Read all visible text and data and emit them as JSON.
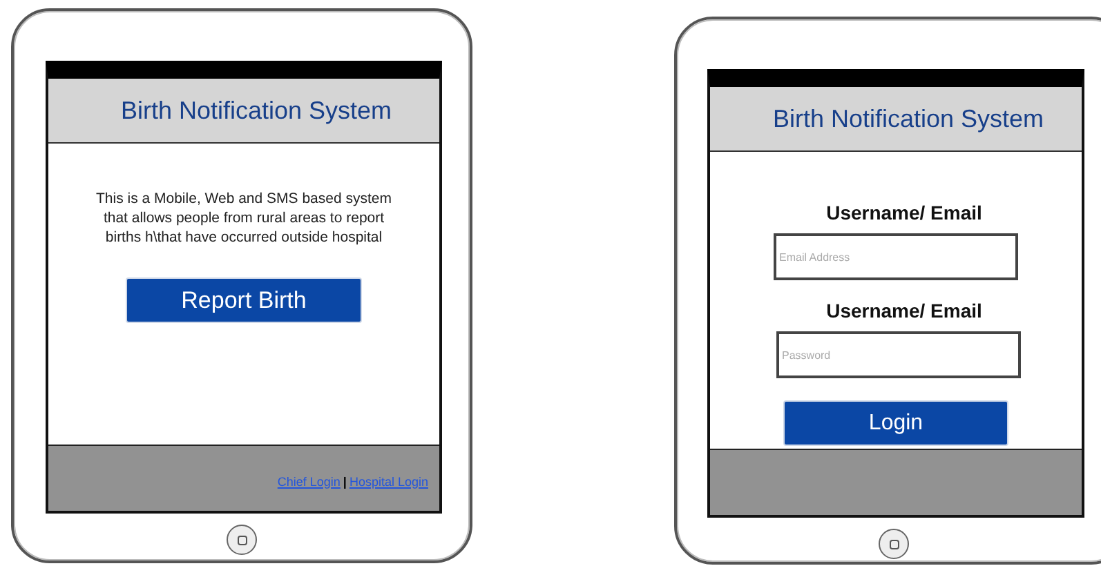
{
  "screens": [
    {
      "kind": "home",
      "title": "Birth Notification System",
      "description": "This is a Mobile, Web and SMS based system\nthat allows people from rural areas to report\nbirths h\\that have occurred outside hospital",
      "button": "Report Birth",
      "footer_links": [
        "Chief Login",
        "Hospital Login"
      ],
      "separator": "|"
    },
    {
      "kind": "login",
      "title": "Birth Notification System",
      "fields": [
        {
          "label": "Username/ Email",
          "placeholder": "Email Address"
        },
        {
          "label": "Username/ Email",
          "placeholder": "Password"
        }
      ],
      "button": "Login"
    }
  ]
}
